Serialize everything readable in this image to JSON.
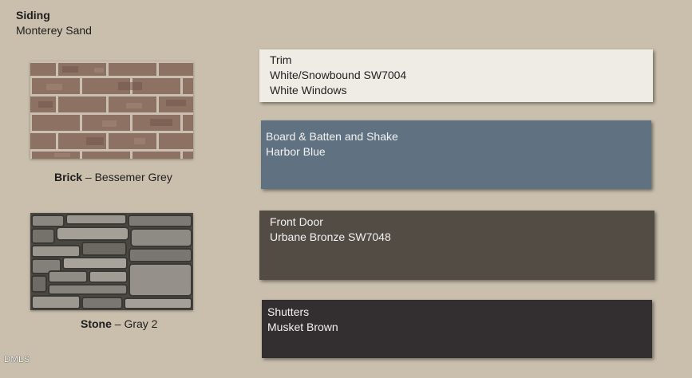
{
  "siding": {
    "title": "Siding",
    "value": "Monterey Sand"
  },
  "brick": {
    "label": "Brick",
    "value": "– Bessemer Grey"
  },
  "stone": {
    "label": "Stone",
    "value": "– Gray 2"
  },
  "trim": {
    "title": "Trim",
    "lines": [
      "White/Snowbound SW7004",
      "White Windows"
    ],
    "color": "#efece6"
  },
  "batten": {
    "title": "Board & Batten and Shake",
    "lines": [
      "Harbor Blue"
    ],
    "color": "#607281"
  },
  "door": {
    "title": "Front Door",
    "lines": [
      "Urbane Bronze SW7048"
    ],
    "color": "#524c45"
  },
  "shutters": {
    "title": "Shutters",
    "lines": [
      "Musket Brown"
    ],
    "color": "#332e2f"
  },
  "watermark": "DMLS",
  "colors": {
    "background": "#c9bfac"
  }
}
